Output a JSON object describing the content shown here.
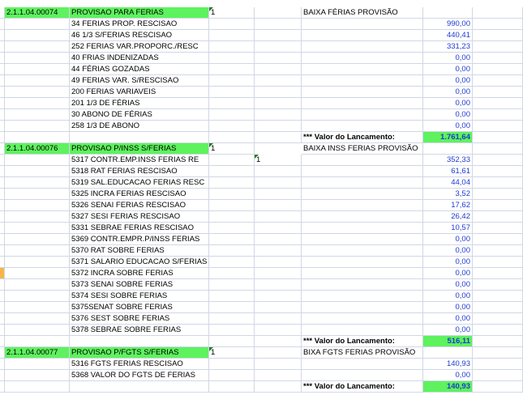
{
  "sections": [
    {
      "account": "2.1.1.04.00074",
      "name": "PROVISAO PARA FERIAS",
      "d_flag": "1",
      "e_flag": "",
      "description": "BAIXA FÉRIAS PROVISÃO",
      "items": [
        {
          "label": "34 FERIAS PROP. RESCISAO",
          "value": "990,00"
        },
        {
          "label": "46 1/3 S/FERIAS RESCISAO",
          "value": "440,41"
        },
        {
          "label": "252 FERIAS VAR.PROPORC./RESC",
          "value": "331,23"
        },
        {
          "label": "40 FRIAS INDENIZADAS",
          "value": "0,00"
        },
        {
          "label": "44 FÉRIAS GOZADAS",
          "value": "0,00"
        },
        {
          "label": "49 FERIAS VAR. S/RESCISAO",
          "value": "0,00"
        },
        {
          "label": "200 FERIAS VARIAVEIS",
          "value": "0,00"
        },
        {
          "label": "201 1/3 DE FÉRIAS",
          "value": "0,00"
        },
        {
          "label": "30 ABONO DE FÉRIAS",
          "value": "0,00"
        },
        {
          "label": "258 1/3 DE ABONO",
          "value": "0,00"
        }
      ],
      "total_label": "*** Valor do Lancamento:",
      "total": "1.761,64"
    },
    {
      "account": "2.1.1.04.00076",
      "name": "PROVISAO P/INSS S/FERIAS",
      "d_flag": "1",
      "e_flag": "1",
      "description": "BAIXA INSS FERIAS PROVISÃO",
      "items": [
        {
          "label": "5317 CONTR.EMP.INSS FERIAS RE",
          "value": "352,33"
        },
        {
          "label": "5318 RAT FERIAS RESCISAO",
          "value": "61,61"
        },
        {
          "label": "5319 SAL.EDUCACAO FERIAS RESC",
          "value": "44,04"
        },
        {
          "label": "5325 INCRA FERIAS RESCISAO",
          "value": "3,52"
        },
        {
          "label": "5326 SENAI FERIAS RESCISAO",
          "value": "17,62"
        },
        {
          "label": "5327 SESI FERIAS RESCISAO",
          "value": "26,42"
        },
        {
          "label": "5331 SEBRAE FERIAS RESCISAO",
          "value": "10,57"
        },
        {
          "label": "5369 CONTR.EMPR.P/INSS FERIAS",
          "value": "0,00"
        },
        {
          "label": "5370 RAT SOBRE FERIAS",
          "value": "0,00"
        },
        {
          "label": "5371 SALARIO EDUCACAO S/FERIAS",
          "value": "0,00"
        },
        {
          "label": "5372 INCRA SOBRE FERIAS",
          "value": "0,00"
        },
        {
          "label": "5373 SENAI SOBRE FERIAS",
          "value": "0,00"
        },
        {
          "label": "5374 SESI SOBRE FERIAS",
          "value": "0,00"
        },
        {
          "label": "5375SENAT SOBRE FERIAS",
          "value": "0,00"
        },
        {
          "label": "5376 SEST SOBRE FERIAS",
          "value": "0,00"
        },
        {
          "label": "5378 SEBRAE SOBRE FERIAS",
          "value": "0,00"
        }
      ],
      "total_label": "*** Valor do Lancamento:",
      "total": "516,11"
    },
    {
      "account": "2.1.1.04.00077",
      "name": "PROVISAO P/FGTS S/FERIAS",
      "d_flag": "1",
      "e_flag": "",
      "description": "BIXA FGTS FERIAS PROVISÃO",
      "items": [
        {
          "label": "5316 FGTS FERIAS RESCISAO",
          "value": "140,93"
        },
        {
          "label": "5368 VALOR DO FGTS DE FERIAS",
          "value": "0,00"
        }
      ],
      "total_label": "*** Valor do Lancamento:",
      "total": "140,93"
    }
  ],
  "colors": {
    "header_fill": "#5ef25e",
    "value_text": "#1f3ad0",
    "gridline": "#d0d7e5",
    "row_marker": "#f7b64a"
  }
}
